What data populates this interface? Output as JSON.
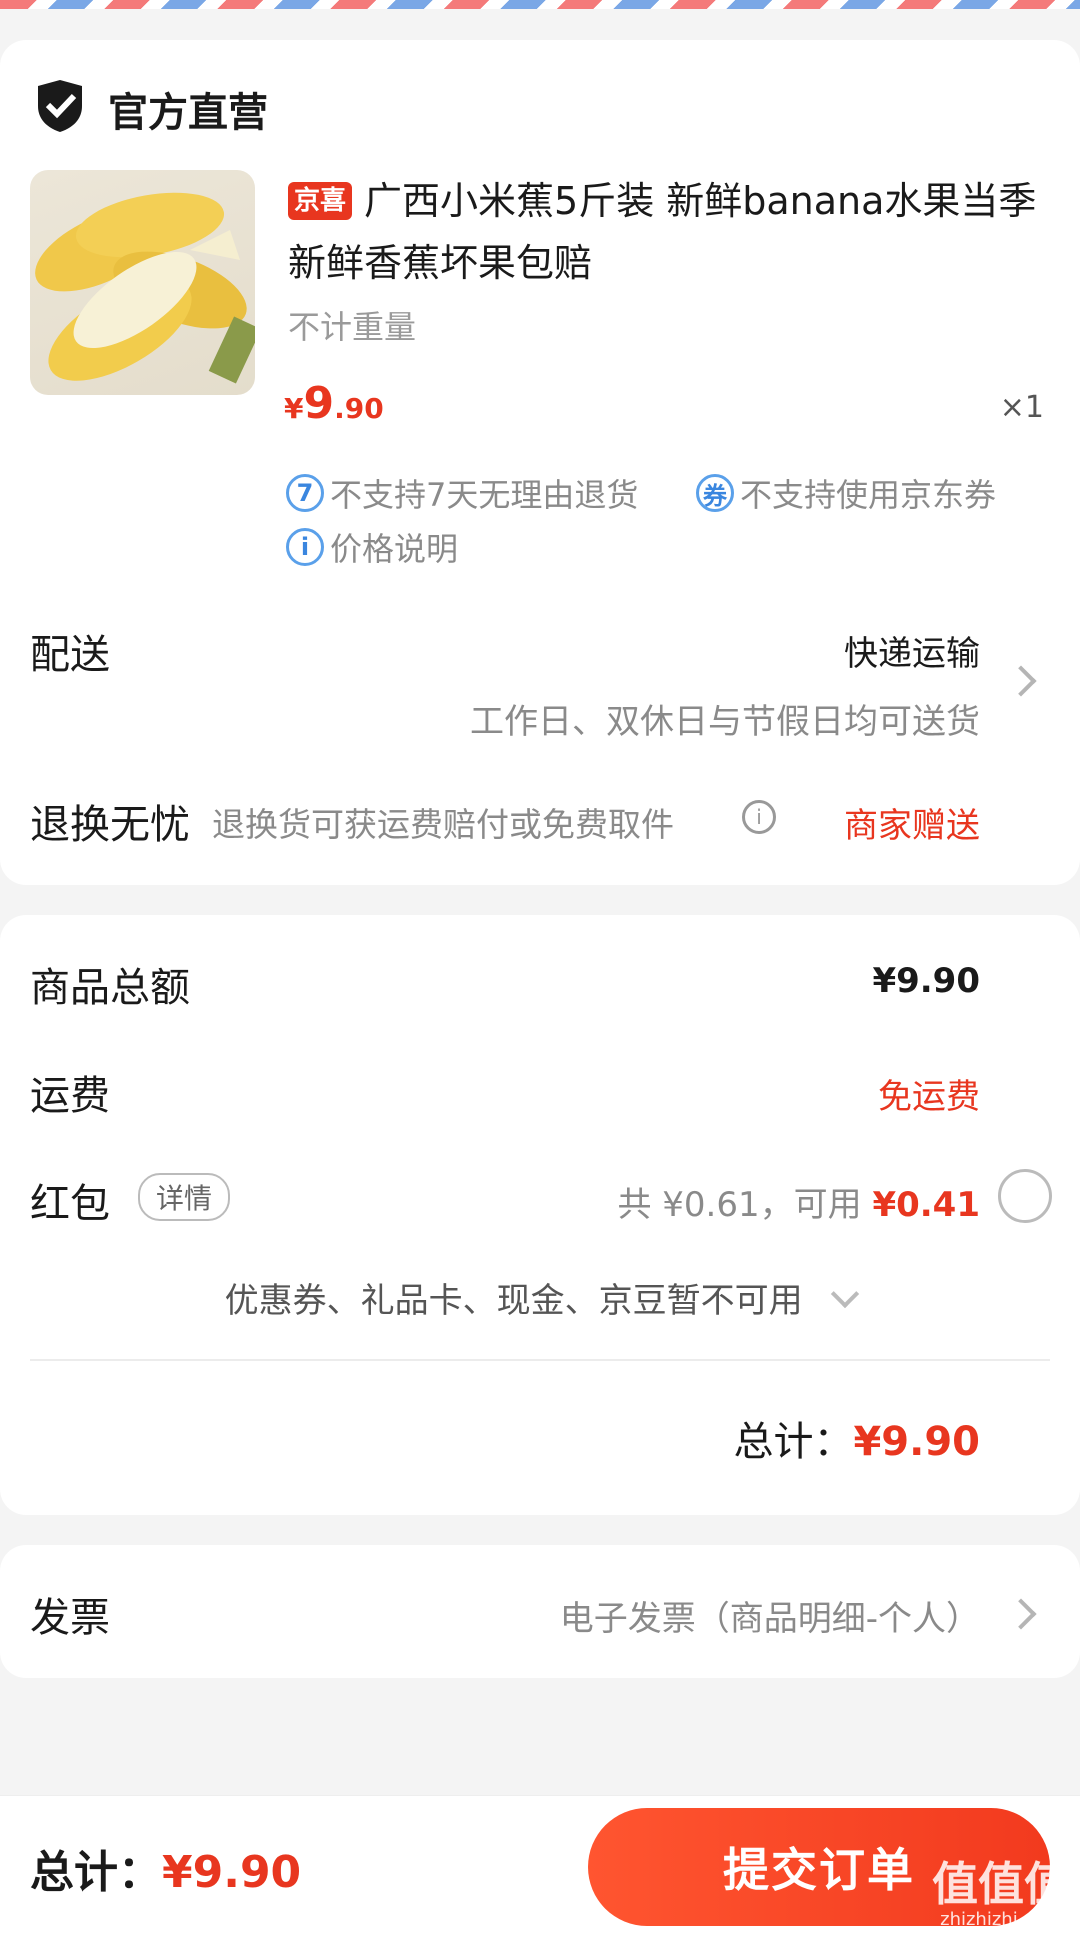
{
  "shop": {
    "type": "官方直营"
  },
  "product": {
    "badge": "京喜",
    "title": "广西小米蕉5斤装 新鲜banana水果当季新鲜香蕉坏果包赔",
    "spec": "不计重量",
    "price_currency": "¥",
    "price_int": "9",
    "price_dec": ".90",
    "quantity": "×1",
    "notices": [
      {
        "icon": "7",
        "text": "不支持7天无理由退货"
      },
      {
        "icon": "券",
        "text": "不支持使用京东券"
      },
      {
        "icon": "i",
        "text": "价格说明"
      }
    ]
  },
  "delivery": {
    "label": "配送",
    "method": "快递运输",
    "note": "工作日、双休日与节假日均可送货"
  },
  "returns": {
    "label": "退换无忧",
    "desc": "退换货可获运费赔付或免费取件",
    "value": "商家赠送"
  },
  "summary": {
    "goods_label": "商品总额",
    "goods_value": "¥9.90",
    "shipping_label": "运费",
    "shipping_value": "免运费",
    "redpacket_label": "红包",
    "redpacket_detail": "详情",
    "redpacket_total": "共 ¥0.61，可用",
    "redpacket_available": "¥0.41",
    "unavailable": "优惠券、礼品卡、现金、京豆暂不可用",
    "total_label": "总计：",
    "total_value": "¥9.90"
  },
  "invoice": {
    "label": "发票",
    "value": "电子发票（商品明细-个人）"
  },
  "footer": {
    "total_label": "总计：",
    "total_value": "¥9.90",
    "submit_label": "提交订单"
  },
  "watermark": {
    "main": "值值值",
    "sub": "zhizhizhi.com"
  },
  "colors": {
    "accent": "#e8361f",
    "icon_blue": "#3a86df",
    "background": "#f4f4f4"
  }
}
